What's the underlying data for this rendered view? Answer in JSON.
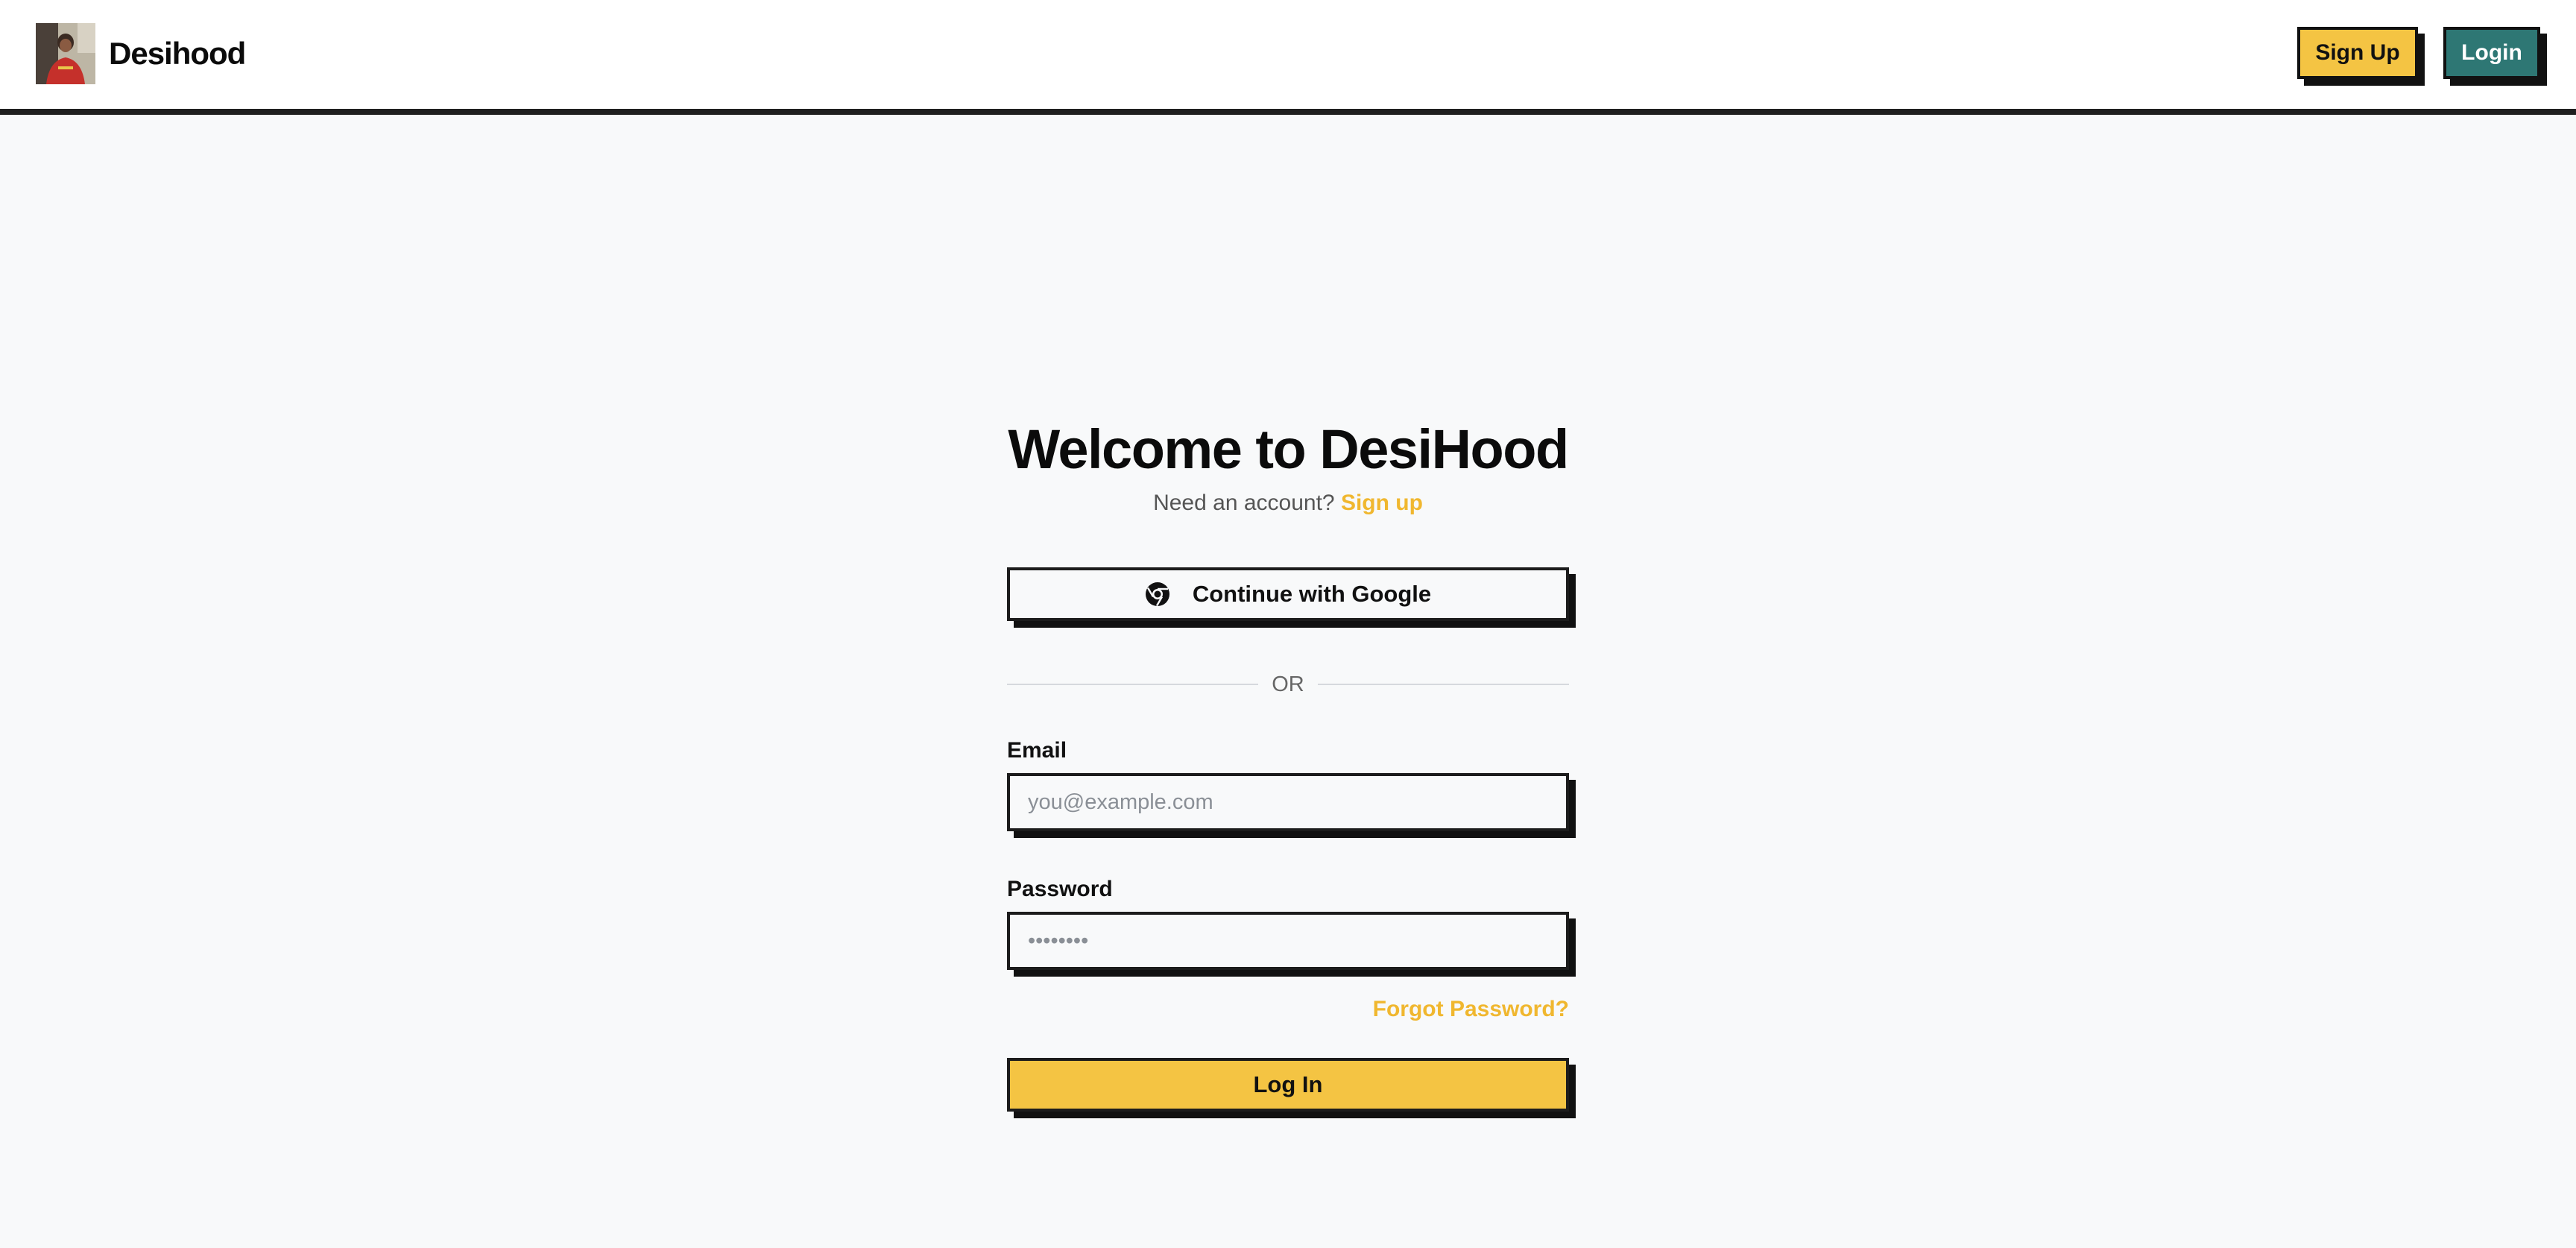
{
  "header": {
    "brand_name": "Desihood",
    "signup_label": "Sign Up",
    "login_label": "Login"
  },
  "form": {
    "title": "Welcome to DesiHood",
    "subtitle_text": "Need an account?",
    "subtitle_link": "Sign up",
    "google_label": "Continue with Google",
    "divider_text": "OR",
    "email_label": "Email",
    "email_placeholder": "you@example.com",
    "password_label": "Password",
    "password_placeholder": "••••••••",
    "forgot_label": "Forgot Password?",
    "submit_label": "Log In"
  },
  "colors": {
    "accent_yellow": "#f4c443",
    "accent_teal": "#2e7774",
    "link_yellow": "#f0b72f",
    "border_dark": "#111111",
    "page_bg": "#f8f9fa"
  },
  "icons": {
    "google": "google-icon",
    "avatar": "user-avatar-photo"
  }
}
